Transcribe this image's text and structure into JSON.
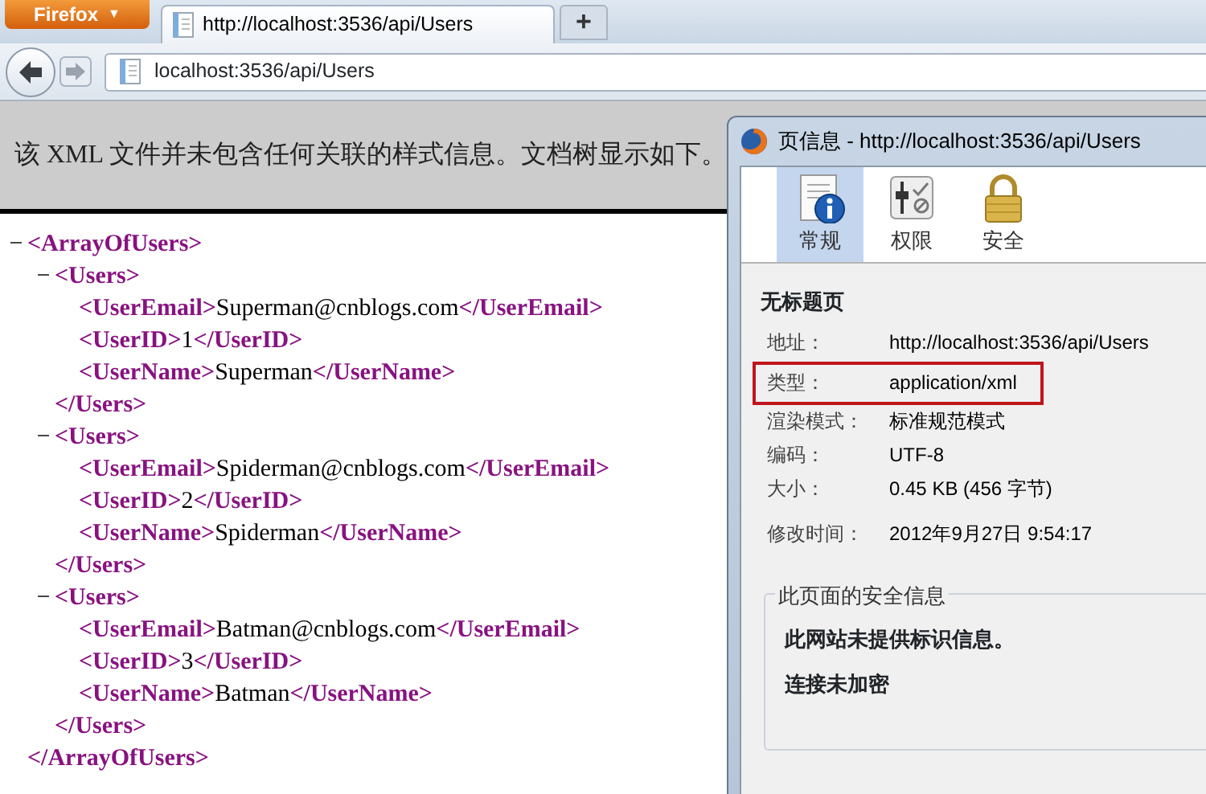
{
  "browser": {
    "menu_button": {
      "label": "Firefox",
      "caret": "▼"
    },
    "tabs": [
      {
        "title": "http://localhost:3536/api/Users",
        "selected": true
      }
    ],
    "new_tab": "+",
    "address": "localhost:3536/api/Users"
  },
  "page": {
    "notice": "该 XML 文件并未包含任何关联的样式信息。文档树显示如下。",
    "xml_tree": [
      {
        "toggle": "−",
        "open": "<ArrayOfUsers>",
        "close": "</ArrayOfUsers>",
        "children": [
          {
            "toggle": "−",
            "open": "<Users>",
            "close": "</Users>",
            "children": [
              {
                "open": "<UserEmail>",
                "value": "Superman@cnblogs.com",
                "close": "</UserEmail>"
              },
              {
                "open": "<UserID>",
                "value": "1",
                "close": "</UserID>"
              },
              {
                "open": "<UserName>",
                "value": "Superman",
                "close": "</UserName>"
              }
            ]
          },
          {
            "toggle": "−",
            "open": "<Users>",
            "close": "</Users>",
            "children": [
              {
                "open": "<UserEmail>",
                "value": "Spiderman@cnblogs.com",
                "close": "</UserEmail>"
              },
              {
                "open": "<UserID>",
                "value": "2",
                "close": "</UserID>"
              },
              {
                "open": "<UserName>",
                "value": "Spiderman",
                "close": "</UserName>"
              }
            ]
          },
          {
            "toggle": "−",
            "open": "<Users>",
            "close": "</Users>",
            "children": [
              {
                "open": "<UserEmail>",
                "value": "Batman@cnblogs.com",
                "close": "</UserEmail>"
              },
              {
                "open": "<UserID>",
                "value": "3",
                "close": "</UserID>"
              },
              {
                "open": "<UserName>",
                "value": "Batman",
                "close": "</UserName>"
              }
            ]
          }
        ]
      }
    ]
  },
  "dialog": {
    "title": "页信息 - http://localhost:3536/api/Users",
    "tabs": [
      {
        "label": "常规",
        "kind": "general",
        "selected": true
      },
      {
        "label": "权限",
        "kind": "permissions",
        "selected": false
      },
      {
        "label": "安全",
        "kind": "security",
        "selected": false
      }
    ],
    "page_title": "无标题页",
    "fields": [
      {
        "label": "地址：",
        "value": "http://localhost:3536/api/Users",
        "highlighted": false
      },
      {
        "label": "类型：",
        "value": "application/xml",
        "highlighted": true
      },
      {
        "label": "渲染模式：",
        "value": "标准规范模式",
        "highlighted": false
      },
      {
        "label": "编码：",
        "value": "UTF-8",
        "highlighted": false
      },
      {
        "label": "大小：",
        "value": "0.45 KB (456 字节)",
        "highlighted": false
      },
      {
        "label": "修改时间：",
        "value": "2012年9月27日 9:54:17",
        "highlighted": false
      }
    ],
    "security": {
      "legend": "此页面的安全信息",
      "lines": [
        "此网站未提供标识信息。",
        "连接未加密"
      ]
    }
  }
}
